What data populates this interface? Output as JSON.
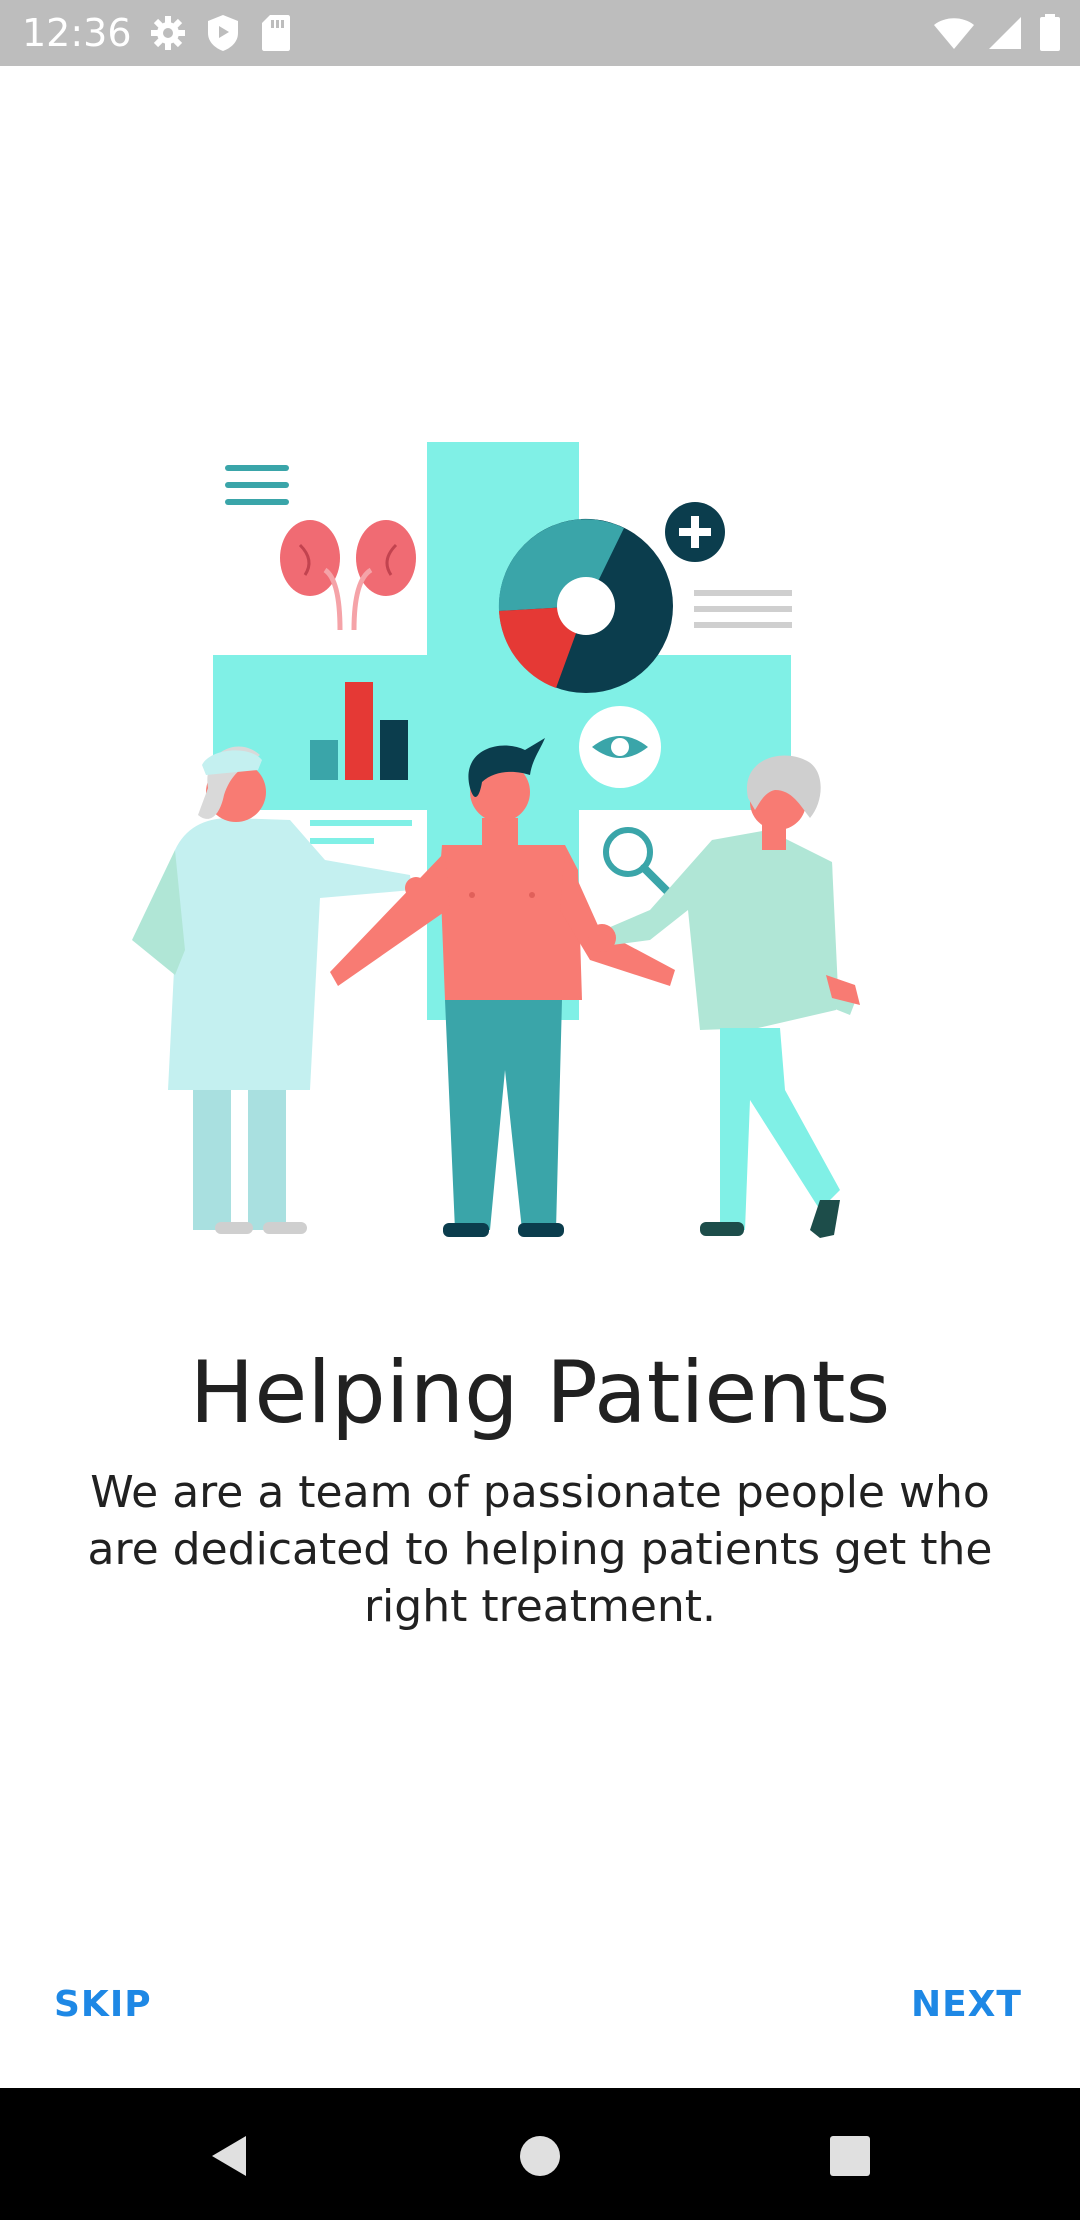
{
  "status_bar": {
    "time": "12:36",
    "left_icons": [
      "gear-icon",
      "shield-icon",
      "sd-card-icon"
    ],
    "right_icons": [
      "wifi-icon",
      "signal-icon",
      "battery-icon"
    ]
  },
  "onboarding": {
    "illustration": "medical-team-patients-illustration",
    "title": "Helping Patients",
    "description": "We are a team of passionate people who are dedicated to helping patients get the right treatment."
  },
  "actions": {
    "skip_label": "SKIP",
    "next_label": "NEXT"
  },
  "nav_bar": {
    "icons": [
      "back-icon",
      "home-icon",
      "recents-icon"
    ]
  },
  "colors": {
    "accent": "#1e88e5",
    "cross": "#80f0e6",
    "coral": "#f87b73",
    "teal": "#3aa5a9",
    "navy": "#0b3d4d",
    "red": "#e53935"
  }
}
